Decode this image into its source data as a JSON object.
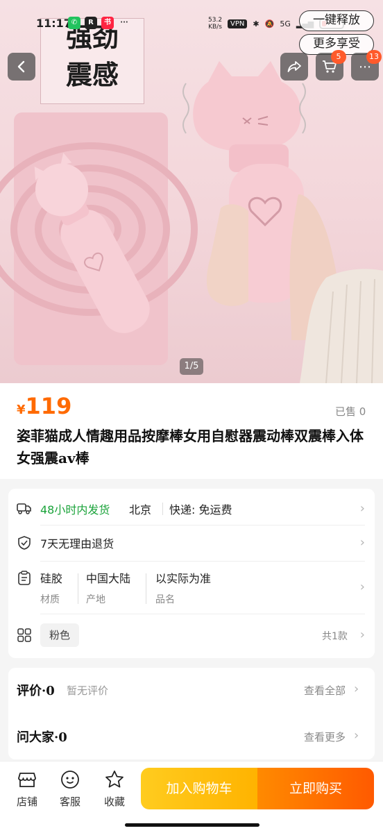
{
  "status_bar": {
    "time": "11:17",
    "net_speed_value": "53.2",
    "net_speed_unit": "KB/s",
    "vpn": "VPN",
    "signal": "5G"
  },
  "top_actions": {
    "release_label": "一键释放",
    "enjoy_label": "更多享受"
  },
  "nav": {
    "cart_badge": "5",
    "more_badge": "13"
  },
  "hero": {
    "overlay_line1": "强劲",
    "overlay_line2": "震感",
    "page_indicator": "1/5"
  },
  "product": {
    "currency": "¥",
    "price": "119",
    "sold": "已售 0",
    "title": "姿菲猫成人情趣用品按摩棒女用自慰器震动棒双震棒入体女强震av棒"
  },
  "details": {
    "shipping_time": "48小时内发货",
    "origin_city": "北京",
    "delivery": "快递: 免运费",
    "return_policy": "7天无理由退货",
    "attrs": [
      {
        "value": "硅胶",
        "label": "材质"
      },
      {
        "value": "中国大陆",
        "label": "产地"
      },
      {
        "value": "以实际为准",
        "label": "品名"
      }
    ],
    "color_option": "粉色",
    "variant_count": "共1款"
  },
  "reviews": {
    "title": "评价·0",
    "empty_text": "暂无评价",
    "view_all": "查看全部",
    "qa_title": "问大家·0",
    "qa_more": "查看更多"
  },
  "bottom_bar": {
    "store_label": "店铺",
    "service_label": "客服",
    "favorite_label": "收藏",
    "add_cart_label": "加入购物车",
    "buy_now_label": "立即购买"
  },
  "colors": {
    "price_orange": "#ff6a00",
    "shipping_green": "#1aa33a",
    "add_cart_yellow": "#ffbf00",
    "buy_now_orange": "#ff6a00",
    "badge_red": "#ff5a2b"
  }
}
